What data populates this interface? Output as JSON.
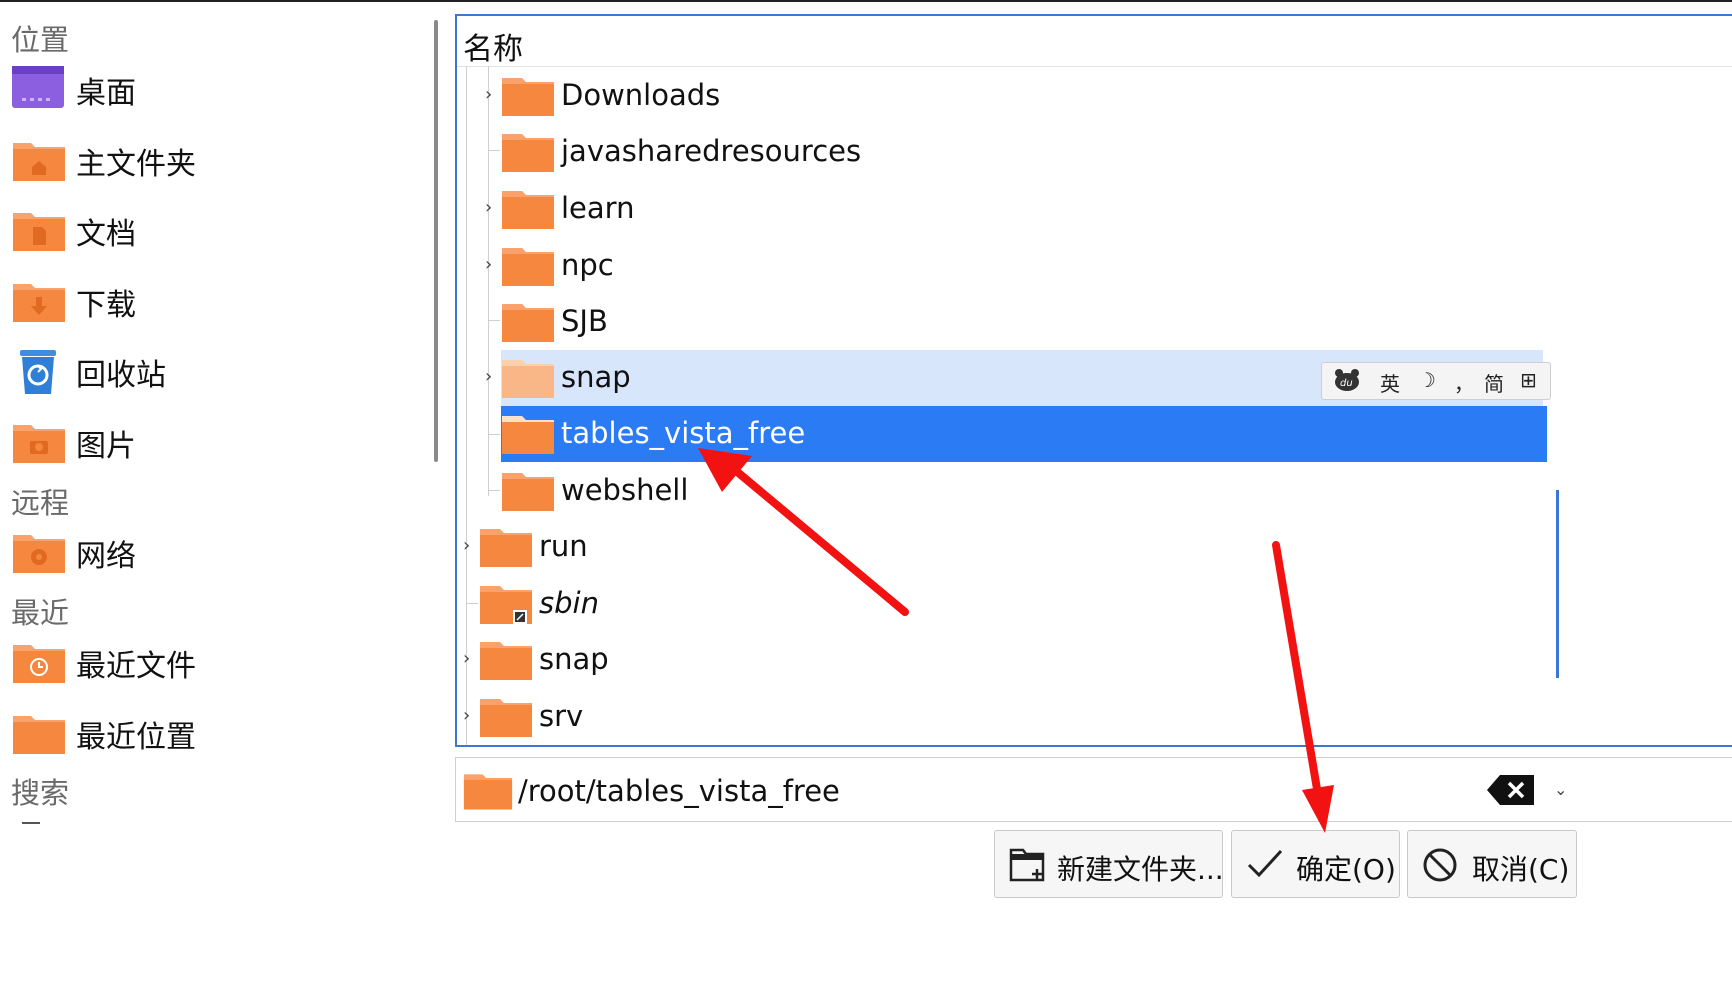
{
  "sidebar": {
    "sections": {
      "places": "位置",
      "remote": "远程",
      "recent": "最近",
      "search": "搜索"
    },
    "items": [
      {
        "label": "桌面",
        "icon": "desktop-icon"
      },
      {
        "label": "主文件夹",
        "icon": "home-folder-icon"
      },
      {
        "label": "文档",
        "icon": "documents-folder-icon"
      },
      {
        "label": "下载",
        "icon": "downloads-folder-icon"
      },
      {
        "label": "回收站",
        "icon": "trash-icon"
      },
      {
        "label": "图片",
        "icon": "pictures-folder-icon"
      },
      {
        "label": "网络",
        "icon": "network-folder-icon"
      },
      {
        "label": "最近文件",
        "icon": "recent-files-icon"
      },
      {
        "label": "最近位置",
        "icon": "recent-locations-icon"
      }
    ]
  },
  "tree": {
    "header": "名称",
    "rows": [
      {
        "name": "Downloads",
        "expandable": true
      },
      {
        "name": "javasharedresources",
        "expandable": false
      },
      {
        "name": "learn",
        "expandable": true
      },
      {
        "name": "npc",
        "expandable": true
      },
      {
        "name": "SJB",
        "expandable": false
      },
      {
        "name": "snap",
        "expandable": true,
        "state": "hover"
      },
      {
        "name": "tables_vista_free",
        "expandable": false,
        "state": "selected"
      },
      {
        "name": "webshell",
        "expandable": false
      },
      {
        "name": "run",
        "expandable": true
      },
      {
        "name": "sbin",
        "expandable": false,
        "symlink": true
      },
      {
        "name": "snap",
        "expandable": true
      },
      {
        "name": "srv",
        "expandable": true
      }
    ]
  },
  "ime": {
    "logo": "du",
    "lang": "英",
    "moon": "☽",
    "punct": "，",
    "mode": "简",
    "menu": "⊞"
  },
  "path": {
    "value": "/root/tables_vista_free"
  },
  "buttons": {
    "new_folder": "新建文件夹...",
    "ok": "确定(O)",
    "cancel": "取消(C)"
  },
  "colors": {
    "folder": "#f5873f",
    "selected": "#2b7bf5",
    "hover": "#d7e6fb",
    "arrow": "#f21212"
  }
}
